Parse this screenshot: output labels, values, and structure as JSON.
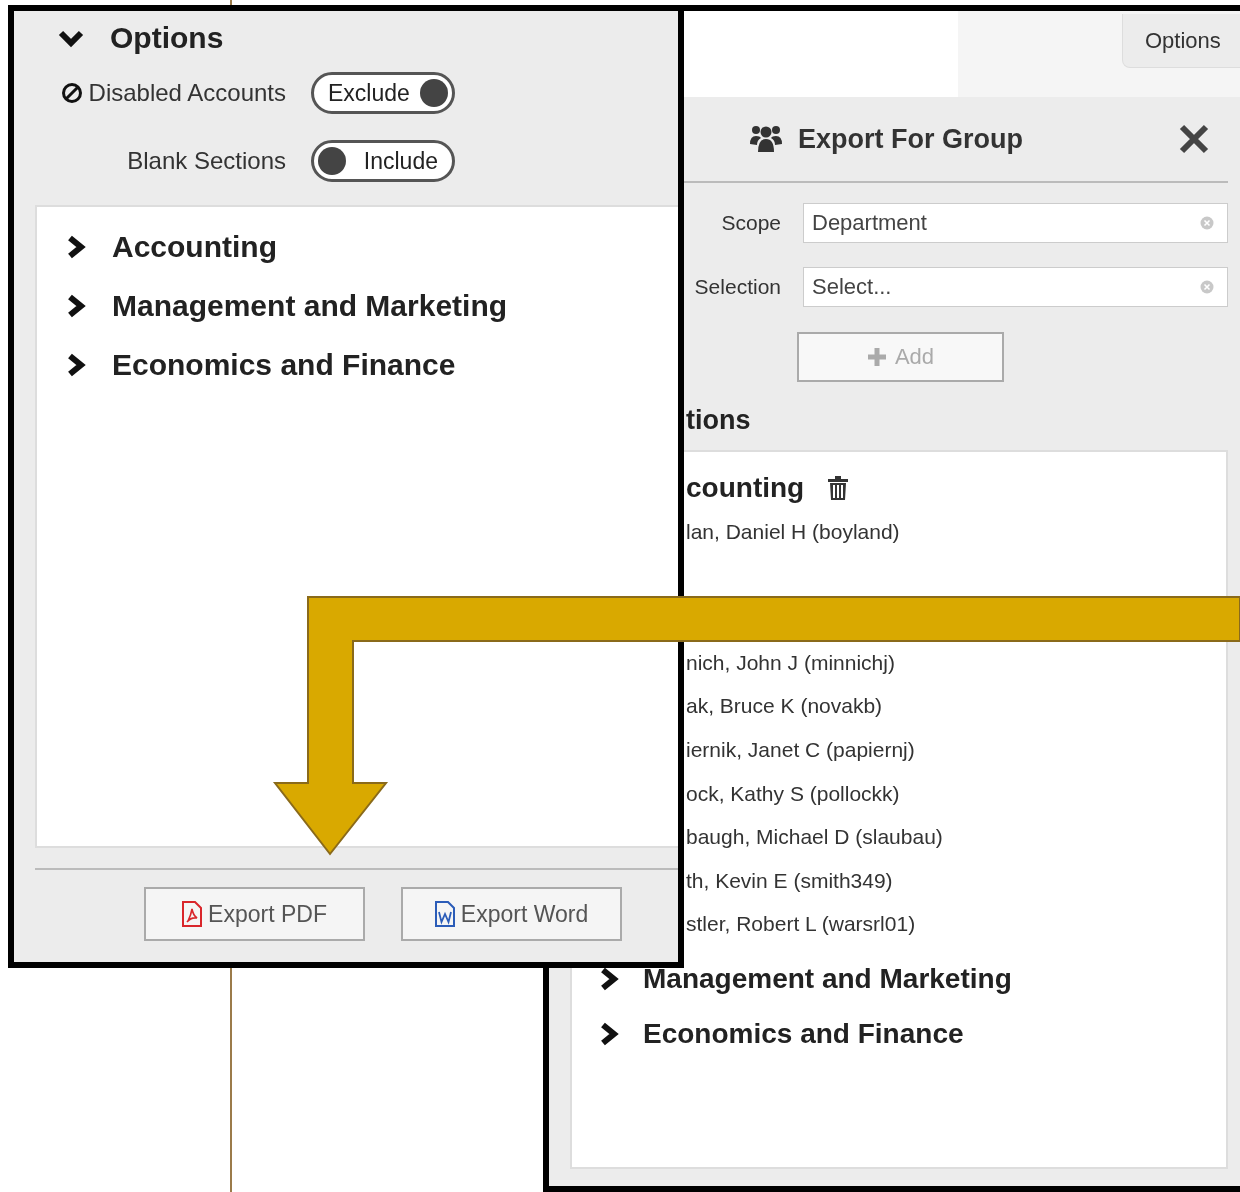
{
  "options_panel": {
    "title": "Options",
    "expanded": true,
    "settings": [
      {
        "kind": "flagged",
        "label": "Disabled Accounts",
        "value": "Exclude",
        "on": true
      },
      {
        "kind": "plain",
        "label": "Blank Sections",
        "value": "Include",
        "on": false
      }
    ],
    "sections": [
      {
        "label": "Accounting",
        "expanded": false
      },
      {
        "label": "Management and Marketing",
        "expanded": false
      },
      {
        "label": "Economics and Finance",
        "expanded": false
      }
    ],
    "buttons": [
      {
        "kind": "pdf",
        "label": "Export PDF"
      },
      {
        "kind": "word",
        "label": "Export Word"
      }
    ]
  },
  "group_dialog": {
    "tab": "Options",
    "title": "Export For Group",
    "fields": [
      {
        "label": "Scope",
        "value": "Department"
      },
      {
        "label": "Selection",
        "placeholder": "Select..."
      }
    ],
    "add_button": "Add",
    "sections_heading": "tions",
    "sections": [
      {
        "label": "counting",
        "expanded": true,
        "members": [
          "lan, Daniel H (boyland)",
          "nich, John J (minnichj)",
          "ak, Bruce K (novakb)",
          "iernik, Janet C (papiernj)",
          "ock, Kathy S (pollockk)",
          "baugh, Michael D (slaubau)",
          "th, Kevin E (smith349)",
          "stler, Robert L (warsrl01)"
        ]
      },
      {
        "label": "Management and Marketing",
        "expanded": false
      },
      {
        "label": "Economics and Finance",
        "expanded": false
      }
    ]
  }
}
